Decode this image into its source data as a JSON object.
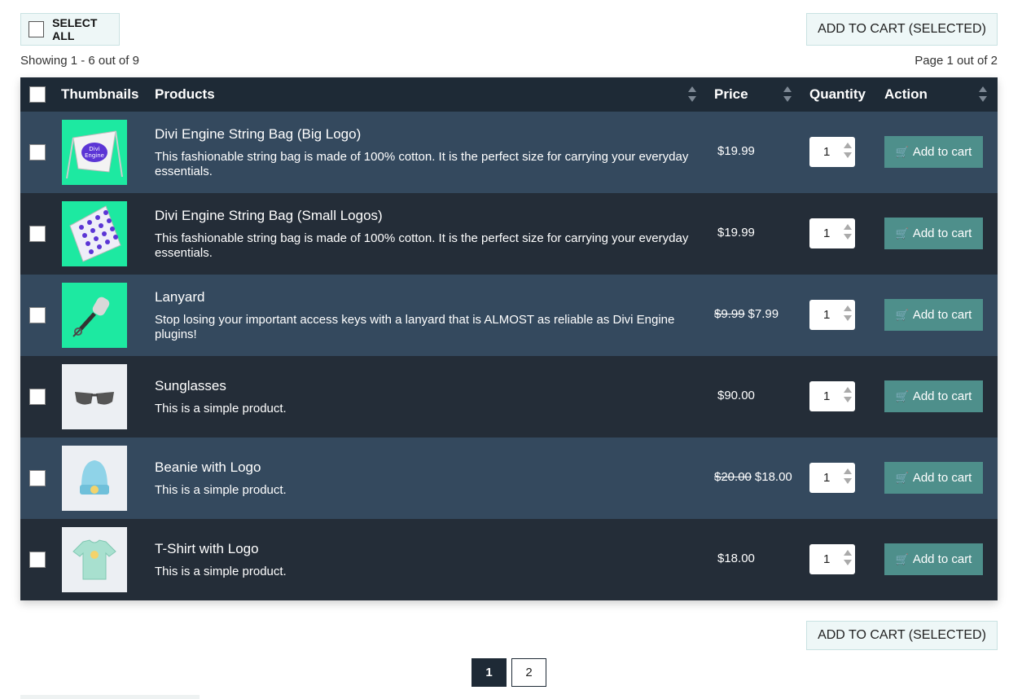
{
  "toolbar": {
    "select_all_label": "SELECT ALL",
    "add_selected_label": "ADD TO CART (SELECTED)"
  },
  "status": {
    "showing": "Showing 1 - 6 out of 9",
    "page_info": "Page 1 out of 2"
  },
  "table": {
    "headers": {
      "thumbnails": "Thumbnails",
      "products": "Products",
      "price": "Price",
      "quantity": "Quantity",
      "action": "Action"
    },
    "rows": [
      {
        "name": "Divi Engine String Bag (Big Logo)",
        "description": "This fashionable string bag is made of 100% cotton. It is the perfect size for carrying your everyday essentials.",
        "old_price": "",
        "price": "$19.99",
        "quantity": "1",
        "action_label": "Add to cart",
        "thumbnail_icon": "string-bag-big-logo-image"
      },
      {
        "name": "Divi Engine String Bag (Small Logos)",
        "description": "This fashionable string bag is made of 100% cotton. It is the perfect size for carrying your everyday essentials.",
        "old_price": "",
        "price": "$19.99",
        "quantity": "1",
        "action_label": "Add to cart",
        "thumbnail_icon": "string-bag-small-logos-image"
      },
      {
        "name": "Lanyard",
        "description": "Stop losing your important access keys with a lanyard that is ALMOST as reliable as Divi Engine plugins!",
        "old_price": "$9.99",
        "price": "$7.99",
        "quantity": "1",
        "action_label": "Add to cart",
        "thumbnail_icon": "lanyard-image"
      },
      {
        "name": "Sunglasses",
        "description": "This is a simple product.",
        "old_price": "",
        "price": "$90.00",
        "quantity": "1",
        "action_label": "Add to cart",
        "thumbnail_icon": "sunglasses-image"
      },
      {
        "name": "Beanie with Logo",
        "description": "This is a simple product.",
        "old_price": "$20.00",
        "price": "$18.00",
        "quantity": "1",
        "action_label": "Add to cart",
        "thumbnail_icon": "beanie-image"
      },
      {
        "name": "T-Shirt with Logo",
        "description": "This is a simple product.",
        "old_price": "",
        "price": "$18.00",
        "quantity": "1",
        "action_label": "Add to cart",
        "thumbnail_icon": "tshirt-image"
      }
    ]
  },
  "pagination": {
    "pages": [
      "1",
      "2"
    ],
    "current": "1"
  },
  "colors": {
    "header_bg": "#1e2a36",
    "row_odd_bg": "#34495e",
    "row_even_bg": "#242d38",
    "button_bg": "#4e8f8b",
    "thumb_green": "#1de9a1"
  }
}
